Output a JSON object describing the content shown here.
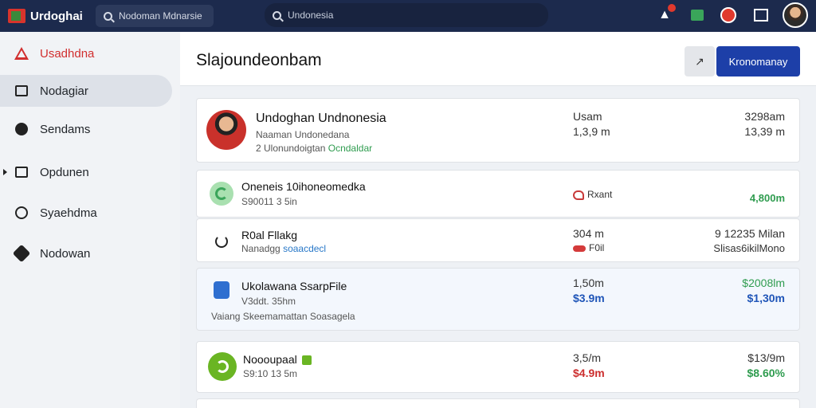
{
  "app": {
    "brand": "Urdoghai"
  },
  "search": {
    "left_text": "Nodoman Mdnarsie",
    "main_text": "Undonesia"
  },
  "sidebar": {
    "items": [
      {
        "label": "Usadhdna",
        "icon": "warning-icon"
      },
      {
        "label": "Nodagiar",
        "icon": "inbox-icon"
      },
      {
        "label": "Sendams",
        "icon": "chat-icon"
      },
      {
        "label": "Opdunen",
        "icon": "folder-icon"
      },
      {
        "label": "Syaehdma",
        "icon": "badge-icon"
      },
      {
        "label": "Nodowan",
        "icon": "gear-icon"
      }
    ]
  },
  "main": {
    "title": "Slajoundeonbam",
    "action_icon": "↗",
    "primary_label": "Kronomanay"
  },
  "profile": {
    "name": "Undoghan Undnonesia",
    "line1": "Naaman Undonedana",
    "line2_prefix": "2 Ulonundoigtan",
    "line2_tag": "Ocndaldar",
    "col1_top": "Usam",
    "col1_bottom": "1,3,9 m",
    "col2_top": "3298am",
    "col2_bottom": "13,39 m"
  },
  "rows": [
    {
      "title": "Oneneis 10ihoneomedka",
      "sub": "S90011 3 5in",
      "mid": "Rxant",
      "right": "4,800m"
    },
    {
      "title": "R0al Fllakg",
      "sub_prefix": "Nanadgg",
      "sub_tag": "soaacdecl",
      "mid_top": "304 m",
      "mid_bottom": "F0il",
      "right_top": "9 12235 Milan",
      "right_bottom": "Slisas6ikilMono"
    },
    {
      "title": "Ukolawana SsarpFile",
      "sub": "V3ddt. 35hm",
      "note": "Vaiang Skeemamattan Soasagela",
      "mid_top": "1,50m",
      "mid_bottom": "$3.9m",
      "right_top": "$2008lm",
      "right_bottom": "$1,30m"
    },
    {
      "title": "Noooupaal",
      "sub": "S9:10 13 5m",
      "mid_top": "3,5/m",
      "mid_bottom": "$4.9m",
      "right_top": "$13/9m",
      "right_bottom": "$8.60%"
    }
  ]
}
